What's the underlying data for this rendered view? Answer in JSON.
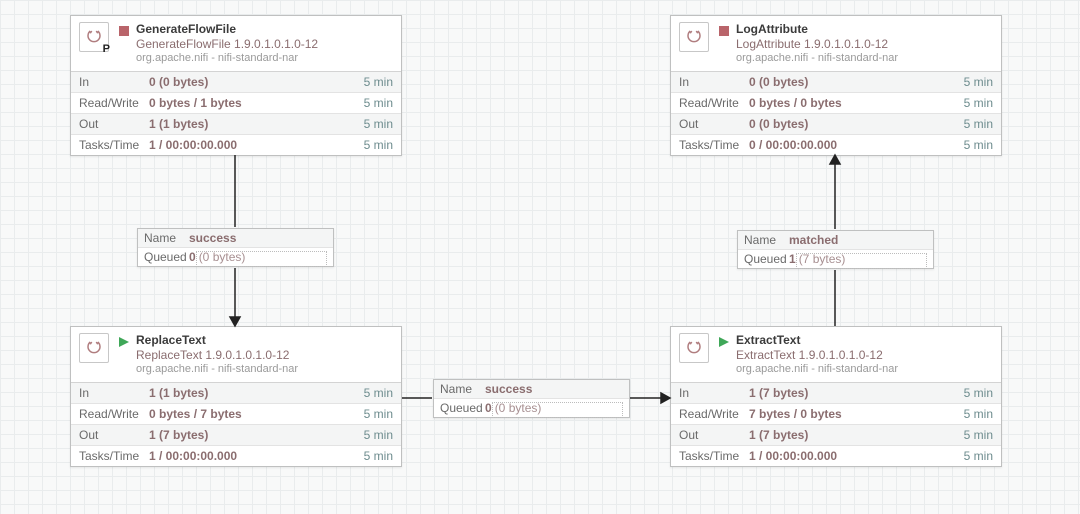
{
  "labels": {
    "name": "Name",
    "queued": "Queued",
    "in": "In",
    "rw": "Read/Write",
    "out": "Out",
    "tt": "Tasks/Time",
    "win": "5 min"
  },
  "processors": {
    "gen": {
      "name": "GenerateFlowFile",
      "type": "GenerateFlowFile 1.9.0.1.0.1.0-12",
      "bundle": "org.apache.nifi - nifi-standard-nar",
      "state": "stopped",
      "pbadge": "P",
      "stats": {
        "in": "0 (0 bytes)",
        "rw": "0 bytes / 1 bytes",
        "out": "1 (1 bytes)",
        "tt": "1 / 00:00:00.000"
      }
    },
    "rep": {
      "name": "ReplaceText",
      "type": "ReplaceText 1.9.0.1.0.1.0-12",
      "bundle": "org.apache.nifi - nifi-standard-nar",
      "state": "running",
      "stats": {
        "in": "1 (1 bytes)",
        "rw": "0 bytes / 7 bytes",
        "out": "1 (7 bytes)",
        "tt": "1 / 00:00:00.000"
      }
    },
    "ext": {
      "name": "ExtractText",
      "type": "ExtractText 1.9.0.1.0.1.0-12",
      "bundle": "org.apache.nifi - nifi-standard-nar",
      "state": "running",
      "stats": {
        "in": "1 (7 bytes)",
        "rw": "7 bytes / 0 bytes",
        "out": "1 (7 bytes)",
        "tt": "1 / 00:00:00.000"
      }
    },
    "log": {
      "name": "LogAttribute",
      "type": "LogAttribute 1.9.0.1.0.1.0-12",
      "bundle": "org.apache.nifi - nifi-standard-nar",
      "state": "stopped",
      "stats": {
        "in": "0 (0 bytes)",
        "rw": "0 bytes / 0 bytes",
        "out": "0 (0 bytes)",
        "tt": "0 / 00:00:00.000"
      }
    }
  },
  "connections": {
    "c1": {
      "name": "success",
      "count": "0",
      "bytes": "(0 bytes)"
    },
    "c2": {
      "name": "success",
      "count": "0",
      "bytes": "(0 bytes)"
    },
    "c3": {
      "name": "matched",
      "count": "1",
      "bytes": "(7 bytes)"
    }
  }
}
